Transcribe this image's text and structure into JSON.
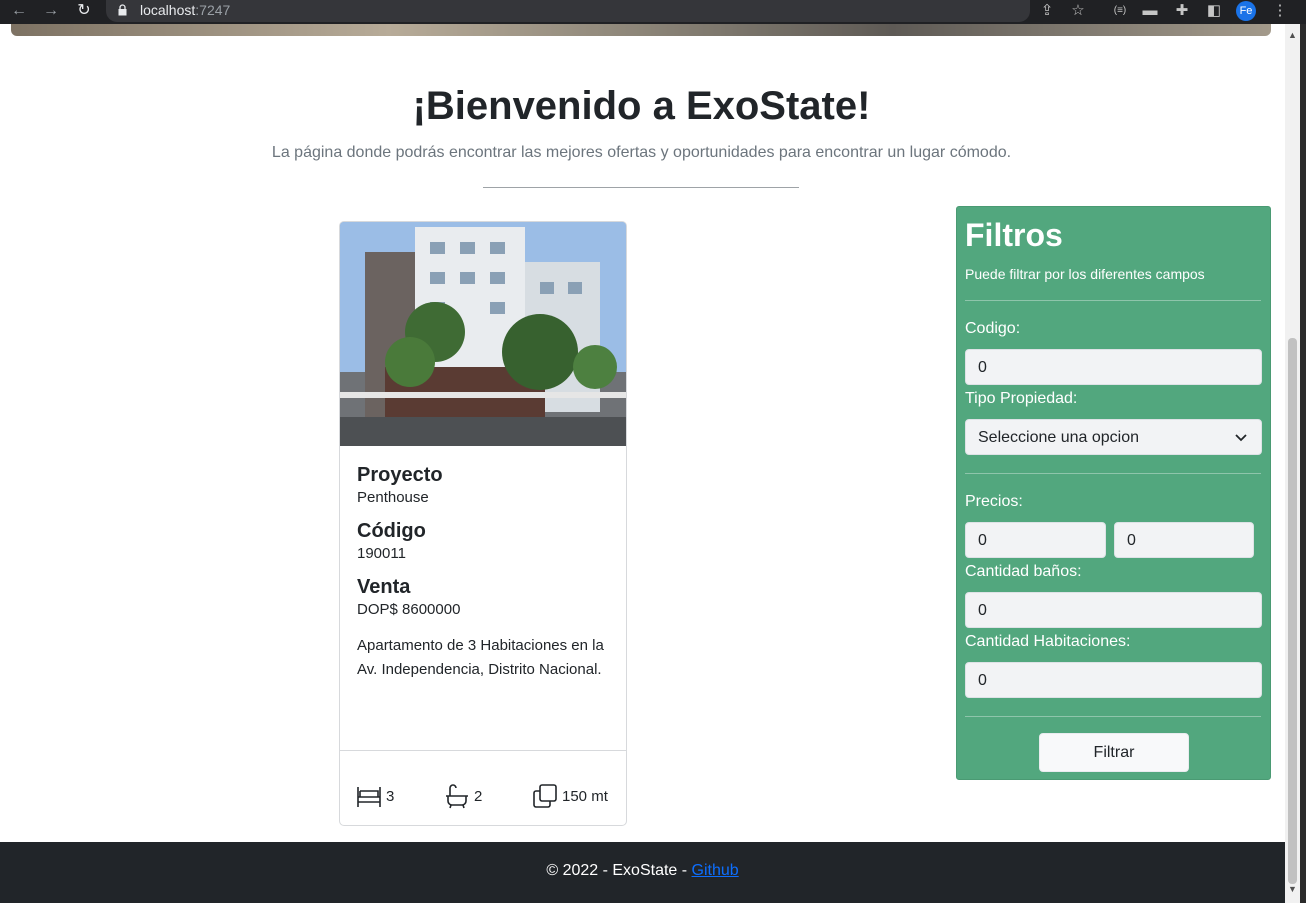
{
  "browser": {
    "url_host": "localhost",
    "url_port": ":7247",
    "profile_initials": "Fe"
  },
  "header": {
    "title": "¡Bienvenido a ExoState!",
    "subtitle": "La página donde podrás encontrar las mejores ofertas y oportunidades para encontrar un lugar cómodo."
  },
  "listing": {
    "project_label": "Proyecto",
    "project_value": "Penthouse",
    "code_label": "Código",
    "code_value": "190011",
    "sale_label": "Venta",
    "sale_value": "DOP$ 8600000",
    "description": "Apartamento de 3 Habitaciones en la Av. Independencia, Distrito Nacional.",
    "bedrooms": "3",
    "bathrooms": "2",
    "area": "150 mt"
  },
  "filters": {
    "title": "Filtros",
    "hint": "Puede filtrar por los diferentes campos",
    "code_label": "Codigo:",
    "code_value": "0",
    "type_label": "Tipo Propiedad:",
    "type_selected": "Seleccione una opcion",
    "price_label": "Precios:",
    "price_min": "0",
    "price_max": "0",
    "baths_label": "Cantidad baños:",
    "baths_value": "0",
    "rooms_label": "Cantidad Habitaciones:",
    "rooms_value": "0",
    "submit_label": "Filtrar"
  },
  "footer": {
    "copyright": "© 2022 - ExoState - ",
    "github_link": "Github"
  },
  "colors": {
    "filter_panel": "#52a77e",
    "footer": "#212529",
    "link": "#0d6efd"
  }
}
